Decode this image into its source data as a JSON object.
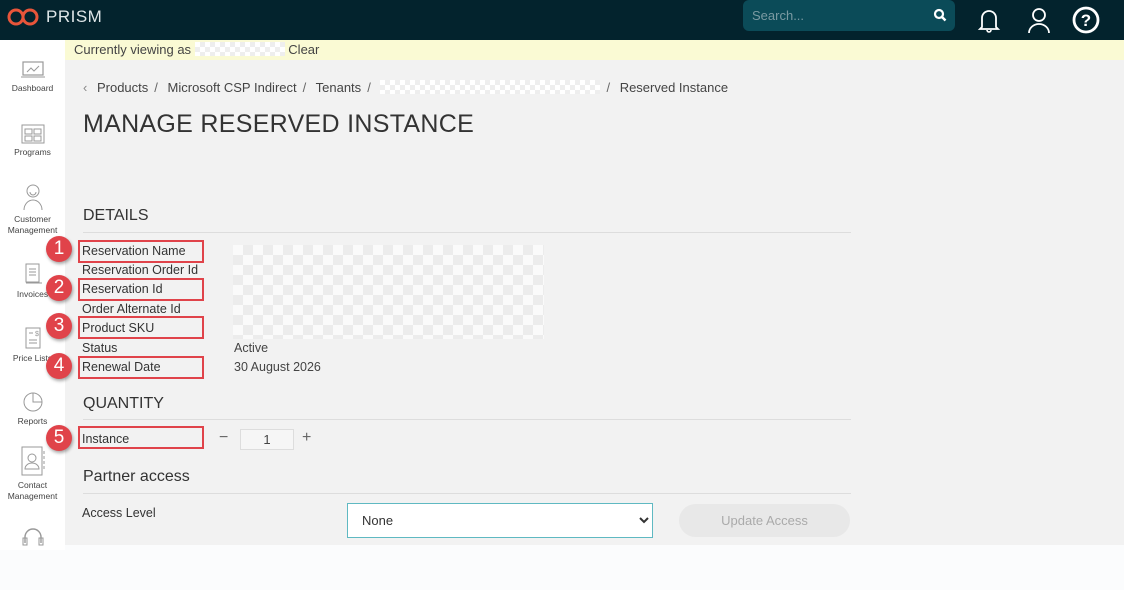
{
  "app": {
    "name": "PRISM",
    "brand_color": "#e8553a",
    "topbar_color": "#03232d"
  },
  "search": {
    "placeholder": "Search...",
    "icon": "search-icon"
  },
  "header_icons": [
    "bell-icon",
    "user-icon",
    "help-icon"
  ],
  "sidebar": {
    "items": [
      {
        "label": "Dashboard",
        "icon": "chart-monitor-icon"
      },
      {
        "label": "Programs",
        "icon": "grid-icon"
      },
      {
        "label": "Customer Management",
        "icon": "person-smile-icon"
      },
      {
        "label": "Invoices",
        "icon": "document-icon"
      },
      {
        "label": "Price Lists",
        "icon": "price-list-icon"
      },
      {
        "label": "Reports",
        "icon": "pie-chart-icon"
      },
      {
        "label": "Contact Management",
        "icon": "contact-book-icon"
      },
      {
        "label": "",
        "icon": "headset-icon"
      }
    ]
  },
  "banner": {
    "text": "Currently viewing as",
    "clear": "Clear"
  },
  "breadcrumb": [
    "Products",
    "Microsoft CSP Indirect",
    "Tenants",
    "Reserved Instance"
  ],
  "page_title": "MANAGE RESERVED INSTANCE",
  "details": {
    "heading": "DETAILS",
    "fields": [
      {
        "label": "Reservation Name",
        "value": ""
      },
      {
        "label": "Reservation Order Id",
        "value": ""
      },
      {
        "label": "Reservation Id",
        "value": ""
      },
      {
        "label": "Order Alternate Id",
        "value": ""
      },
      {
        "label": "Product SKU",
        "value": ""
      },
      {
        "label": "Status",
        "value": "Active"
      },
      {
        "label": "Renewal Date",
        "value": "30 August 2026"
      }
    ]
  },
  "quantity": {
    "heading": "QUANTITY",
    "label": "Instance",
    "value": "1",
    "minus": "−",
    "plus": "+"
  },
  "partner": {
    "heading": "Partner access",
    "label": "Access Level",
    "selected": "None",
    "button": "Update Access"
  },
  "annotations": [
    "1",
    "2",
    "3",
    "4",
    "5"
  ]
}
